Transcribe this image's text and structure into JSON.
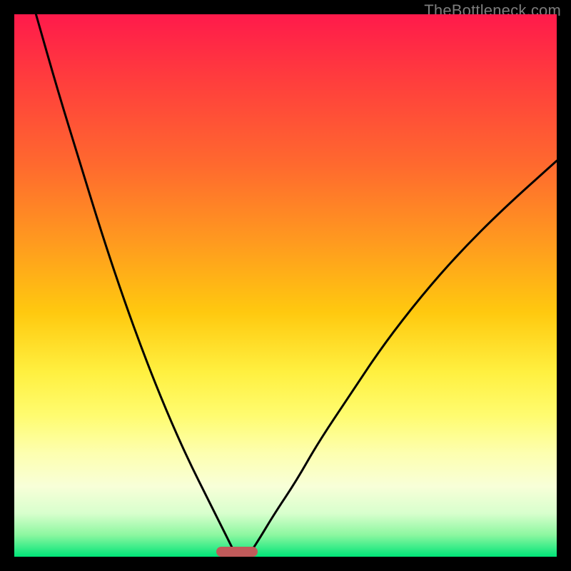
{
  "watermark": "TheBottleneck.com",
  "colors": {
    "frame": "#000000",
    "curve": "#000000",
    "marker": "#c05a5a",
    "gradient_top": "#ff1a4b",
    "gradient_bottom": "#00e478"
  },
  "chart_data": {
    "type": "line",
    "title": "",
    "xlabel": "",
    "ylabel": "",
    "xlim": [
      0,
      100
    ],
    "ylim": [
      0,
      100
    ],
    "grid": false,
    "legend": false,
    "annotations": [
      {
        "name": "optimal-marker",
        "x": 41,
        "y": 0,
        "shape": "rounded-bar"
      }
    ],
    "series": [
      {
        "name": "left-branch",
        "x": [
          4,
          8,
          12,
          16,
          20,
          24,
          28,
          32,
          36,
          38,
          40,
          41
        ],
        "y": [
          100,
          86,
          73,
          60,
          48,
          37,
          27,
          18,
          10,
          6,
          2,
          0
        ]
      },
      {
        "name": "right-branch",
        "x": [
          43,
          45,
          48,
          52,
          56,
          62,
          68,
          75,
          82,
          90,
          100
        ],
        "y": [
          0,
          3,
          8,
          14,
          21,
          30,
          39,
          48,
          56,
          64,
          73
        ]
      }
    ]
  }
}
